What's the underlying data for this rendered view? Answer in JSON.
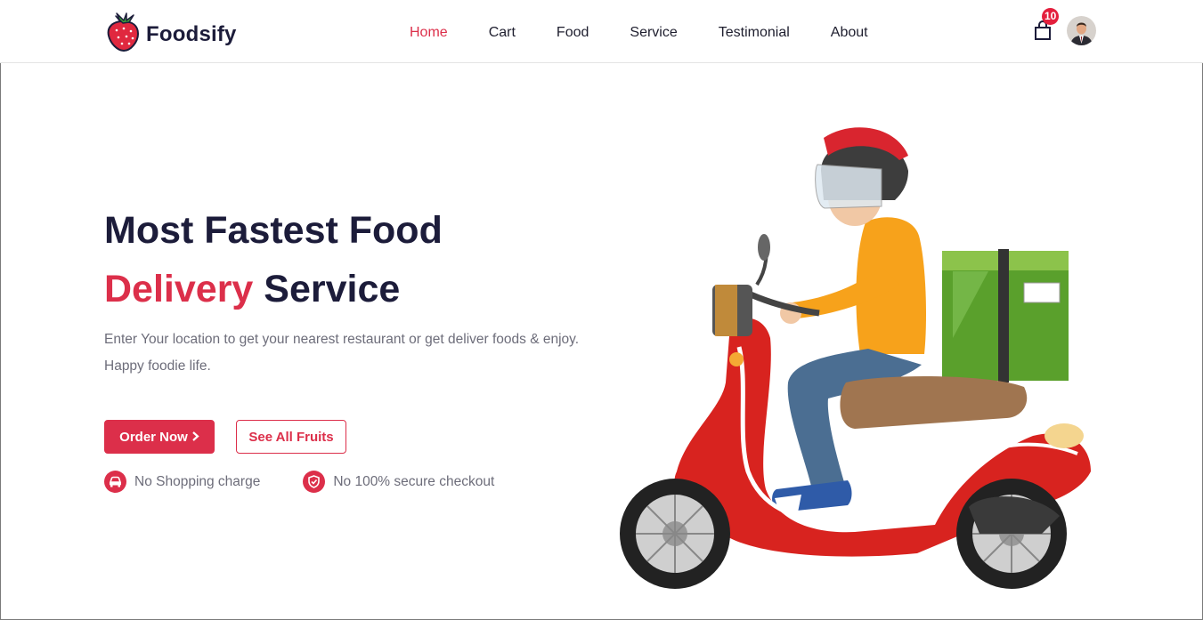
{
  "brand": {
    "name": "Foodsify",
    "logo_icon": "strawberry-icon"
  },
  "nav": {
    "items": [
      {
        "label": "Home",
        "active": true
      },
      {
        "label": "Cart",
        "active": false
      },
      {
        "label": "Food",
        "active": false
      },
      {
        "label": "Service",
        "active": false
      },
      {
        "label": "Testimonial",
        "active": false
      },
      {
        "label": "About",
        "active": false
      }
    ]
  },
  "header_actions": {
    "cart_icon": "shopping-bag-icon",
    "cart_count": "10",
    "avatar_icon": "user-avatar-icon"
  },
  "hero": {
    "title_line1": "Most Fastest Food",
    "title_accent": "Delivery",
    "title_rest": "Service",
    "description_line1": "Enter Your location to get your nearest restaurant or get deliver foods & enjoy.",
    "description_line2": "Happy foodie life.",
    "primary_button": "Order Now",
    "primary_button_icon": "chevron-right-icon",
    "secondary_button": "See All Fruits",
    "features": [
      {
        "label": "No Shopping charge",
        "icon": "car-icon"
      },
      {
        "label": "No 100% secure checkout",
        "icon": "shield-check-icon"
      }
    ],
    "illustration": "delivery-scooter-rider-illustration"
  },
  "colors": {
    "accent": "#dc2f4a",
    "heading": "#1c1c3a",
    "body_text": "#6d6d7a",
    "badge": "#e41f3d"
  }
}
